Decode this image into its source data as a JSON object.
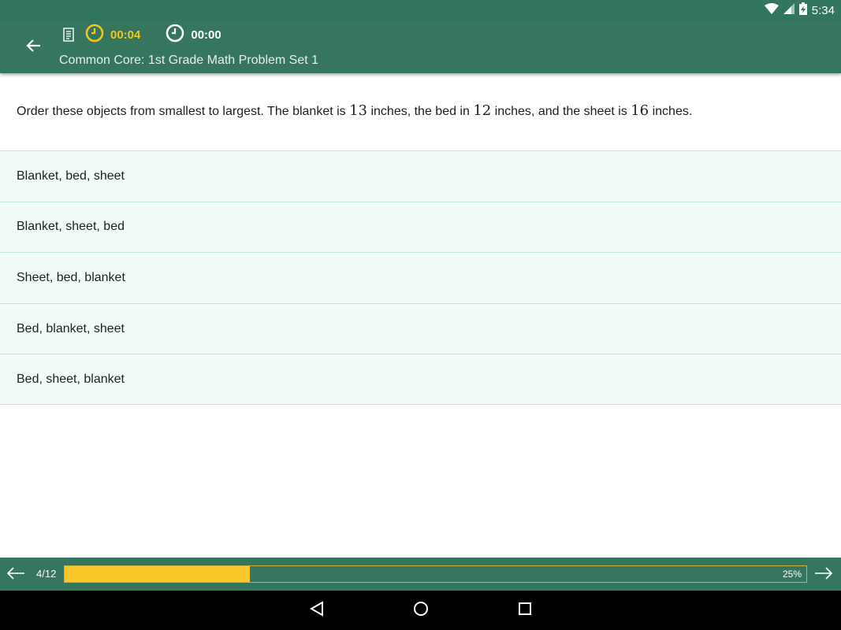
{
  "status_bar": {
    "time": "5:34",
    "icons": [
      "wifi-icon",
      "signal-icon",
      "battery-charging-icon"
    ]
  },
  "app_bar": {
    "back_icon": "arrow-back-icon",
    "doc_icon": "document-list-icon",
    "question_timer": "00:04",
    "total_timer": "00:00",
    "title": "Common Core: 1st Grade Math Problem Set 1",
    "colors": {
      "bar": "#36765f",
      "timer_active": "#f5c518"
    }
  },
  "question": {
    "parts": [
      "Order these objects from smallest to largest. The blanket is ",
      " inches, the bed in ",
      " inches, and the sheet is ",
      " inches."
    ],
    "numbers": [
      "13",
      "12",
      "16"
    ]
  },
  "answers": [
    {
      "label": "Blanket, bed, sheet"
    },
    {
      "label": "Blanket, sheet, bed"
    },
    {
      "label": "Sheet, bed, blanket"
    },
    {
      "label": "Bed, blanket, sheet"
    },
    {
      "label": "Bed, sheet, blanket"
    }
  ],
  "footer": {
    "page": "4/12",
    "progress_percent": 25,
    "progress_text": "25%",
    "colors": {
      "fill": "#fbc72a"
    }
  },
  "system_nav": {
    "icons": [
      "back-triangle-icon",
      "home-circle-icon",
      "recents-square-icon"
    ]
  }
}
